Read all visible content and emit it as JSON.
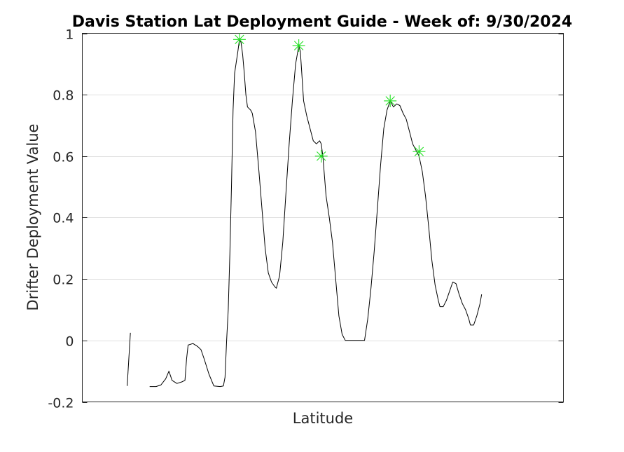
{
  "chart_data": {
    "type": "line",
    "title": "Davis Station Lat Deployment Guide - Week of: 9/30/2024",
    "xlabel": "Latitude",
    "ylabel": "Drifter Deployment Value",
    "xlim": [
      0,
      150
    ],
    "ylim": [
      -0.2,
      1
    ],
    "yticks": [
      -0.2,
      0,
      0.2,
      0.4,
      0.6,
      0.8,
      1
    ],
    "ytick_labels": [
      "-0.2",
      "0",
      "0.2",
      "0.4",
      "0.6",
      "0.8",
      "1"
    ],
    "xticks_labeled": false,
    "grid": "y-major",
    "series_color": "#000000",
    "marker_color": "#22e022",
    "segments": [
      [
        [
          14,
          -0.148
        ],
        [
          15,
          0.025
        ]
      ],
      [
        [
          21,
          -0.15
        ],
        [
          23,
          -0.15
        ],
        [
          24.5,
          -0.145
        ],
        [
          26,
          -0.125
        ],
        [
          27,
          -0.1
        ],
        [
          28,
          -0.13
        ],
        [
          29.5,
          -0.14
        ],
        [
          31,
          -0.135
        ],
        [
          32,
          -0.13
        ],
        [
          32.5,
          -0.06
        ],
        [
          33,
          -0.015
        ],
        [
          34.5,
          -0.01
        ],
        [
          36,
          -0.02
        ],
        [
          37,
          -0.03
        ],
        [
          38,
          -0.06
        ],
        [
          39.5,
          -0.11
        ],
        [
          41,
          -0.148
        ],
        [
          43,
          -0.15
        ],
        [
          44,
          -0.148
        ],
        [
          44.5,
          -0.12
        ],
        [
          45,
          0.0
        ],
        [
          45.5,
          0.1
        ],
        [
          46,
          0.28
        ],
        [
          46.5,
          0.5
        ],
        [
          47,
          0.75
        ],
        [
          47.5,
          0.87
        ],
        [
          48.5,
          0.94
        ],
        [
          49,
          0.98
        ],
        [
          49.5,
          0.97
        ],
        [
          50,
          0.93
        ],
        [
          50.5,
          0.87
        ],
        [
          51,
          0.8
        ],
        [
          51.5,
          0.76
        ],
        [
          52.5,
          0.75
        ],
        [
          53,
          0.74
        ],
        [
          54,
          0.68
        ],
        [
          55,
          0.56
        ],
        [
          56,
          0.43
        ],
        [
          57,
          0.3
        ],
        [
          58,
          0.22
        ],
        [
          59,
          0.19
        ],
        [
          60,
          0.175
        ],
        [
          60.5,
          0.17
        ],
        [
          61.5,
          0.21
        ],
        [
          62.5,
          0.32
        ],
        [
          63.5,
          0.48
        ],
        [
          64.5,
          0.64
        ],
        [
          65.5,
          0.78
        ],
        [
          66.5,
          0.9
        ],
        [
          67.5,
          0.96
        ],
        [
          68,
          0.94
        ],
        [
          69,
          0.78
        ],
        [
          70,
          0.73
        ],
        [
          71,
          0.69
        ],
        [
          72,
          0.65
        ],
        [
          73,
          0.64
        ],
        [
          74,
          0.65
        ],
        [
          74.5,
          0.64
        ],
        [
          75,
          0.6
        ],
        [
          76,
          0.47
        ],
        [
          77,
          0.4
        ],
        [
          78,
          0.32
        ],
        [
          79,
          0.2
        ],
        [
          80,
          0.08
        ],
        [
          81,
          0.02
        ],
        [
          82,
          0.0
        ],
        [
          84,
          0.0
        ],
        [
          86,
          0.0
        ],
        [
          88,
          0.0
        ],
        [
          89,
          0.07
        ],
        [
          90,
          0.17
        ],
        [
          91,
          0.29
        ],
        [
          92,
          0.43
        ],
        [
          93,
          0.57
        ],
        [
          94,
          0.69
        ],
        [
          95,
          0.75
        ],
        [
          96,
          0.78
        ],
        [
          97,
          0.76
        ],
        [
          98,
          0.77
        ],
        [
          99,
          0.765
        ],
        [
          100,
          0.74
        ],
        [
          101,
          0.72
        ],
        [
          102,
          0.68
        ],
        [
          103,
          0.64
        ],
        [
          104,
          0.62
        ],
        [
          105,
          0.6
        ],
        [
          106,
          0.55
        ],
        [
          107,
          0.47
        ],
        [
          108,
          0.37
        ],
        [
          109,
          0.26
        ],
        [
          110,
          0.18
        ],
        [
          111,
          0.13
        ],
        [
          111.5,
          0.11
        ],
        [
          112.5,
          0.11
        ],
        [
          113.5,
          0.13
        ],
        [
          114.5,
          0.16
        ],
        [
          115.5,
          0.19
        ],
        [
          116.5,
          0.185
        ],
        [
          117.5,
          0.15
        ],
        [
          118.5,
          0.12
        ],
        [
          119.5,
          0.1
        ],
        [
          120.5,
          0.07
        ],
        [
          121,
          0.05
        ],
        [
          122,
          0.05
        ],
        [
          123,
          0.08
        ],
        [
          124,
          0.12
        ],
        [
          124.5,
          0.15
        ]
      ]
    ],
    "peaks": [
      [
        49,
        0.98
      ],
      [
        67.5,
        0.96
      ],
      [
        74.5,
        0.6
      ],
      [
        96,
        0.78
      ],
      [
        105,
        0.615
      ]
    ]
  }
}
